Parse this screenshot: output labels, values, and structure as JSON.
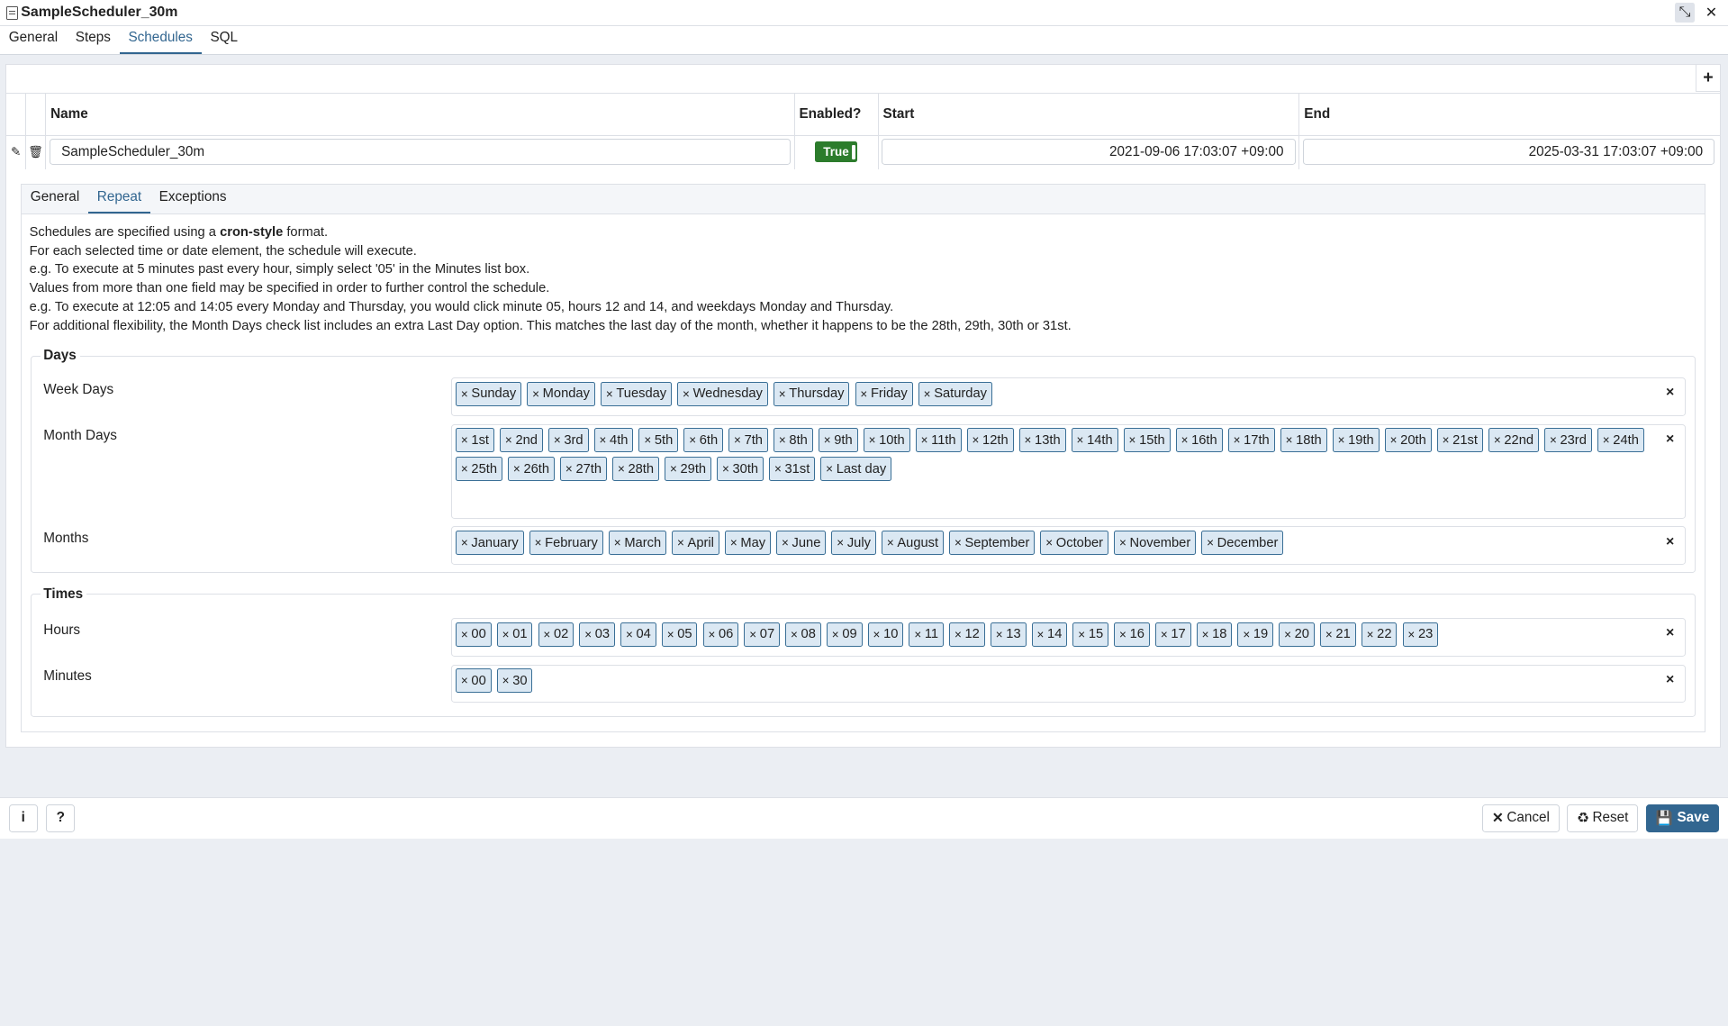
{
  "window": {
    "title": "SampleScheduler_30m"
  },
  "tabs": [
    "General",
    "Steps",
    "Schedules",
    "SQL"
  ],
  "schedules": {
    "columns": {
      "name": "Name",
      "enabled": "Enabled?",
      "start": "Start",
      "end": "End"
    },
    "row": {
      "name": "SampleScheduler_30m",
      "enabled": "True",
      "start": "2021-09-06 17:03:07 +09:00",
      "end": "2025-03-31 17:03:07 +09:00"
    },
    "add_label": "+"
  },
  "subtabs": [
    "General",
    "Repeat",
    "Exceptions"
  ],
  "description": {
    "line1_pre": "Schedules are specified using a ",
    "line1_bold": "cron-style",
    "line1_post": " format.",
    "line2": "For each selected time or date element, the schedule will execute.",
    "line3": "e.g. To execute at 5 minutes past every hour, simply select '05' in the Minutes list box.",
    "line4": "Values from more than one field may be specified in order to further control the schedule.",
    "line5": "e.g. To execute at 12:05 and 14:05 every Monday and Thursday, you would click minute 05, hours 12 and 14, and weekdays Monday and Thursday.",
    "line6": "For additional flexibility, the Month Days check list includes an extra Last Day option. This matches the last day of the month, whether it happens to be the 28th, 29th, 30th or 31st."
  },
  "days": {
    "legend": "Days",
    "week_days_label": "Week Days",
    "week_days": [
      "Sunday",
      "Monday",
      "Tuesday",
      "Wednesday",
      "Thursday",
      "Friday",
      "Saturday"
    ],
    "month_days_label": "Month Days",
    "month_days": [
      "1st",
      "2nd",
      "3rd",
      "4th",
      "5th",
      "6th",
      "7th",
      "8th",
      "9th",
      "10th",
      "11th",
      "12th",
      "13th",
      "14th",
      "15th",
      "16th",
      "17th",
      "18th",
      "19th",
      "20th",
      "21st",
      "22nd",
      "23rd",
      "24th",
      "25th",
      "26th",
      "27th",
      "28th",
      "29th",
      "30th",
      "31st",
      "Last day"
    ],
    "months_label": "Months",
    "months": [
      "January",
      "February",
      "March",
      "April",
      "May",
      "June",
      "July",
      "August",
      "September",
      "October",
      "November",
      "December"
    ]
  },
  "times": {
    "legend": "Times",
    "hours_label": "Hours",
    "hours": [
      "00",
      "01",
      "02",
      "03",
      "04",
      "05",
      "06",
      "07",
      "08",
      "09",
      "10",
      "11",
      "12",
      "13",
      "14",
      "15",
      "16",
      "17",
      "18",
      "19",
      "20",
      "21",
      "22",
      "23"
    ],
    "minutes_label": "Minutes",
    "minutes": [
      "00",
      "30"
    ]
  },
  "icons": {
    "tag_remove": "×",
    "clear": "×"
  },
  "footer": {
    "info": "i",
    "help": "?",
    "cancel": "Cancel",
    "reset": "Reset",
    "save": "Save"
  },
  "colors": {
    "accent": "#326690",
    "toggle_on": "#2c7c2c",
    "tag_bg": "#dbe8f3"
  }
}
